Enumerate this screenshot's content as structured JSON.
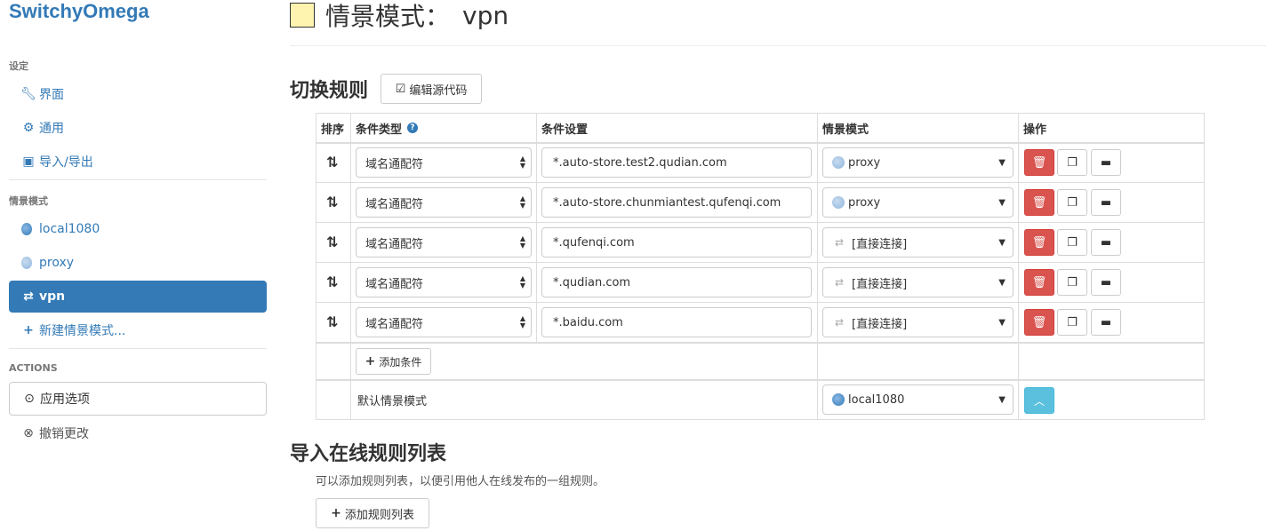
{
  "app": {
    "title": "SwitchyOmega"
  },
  "sidebar": {
    "settings_header": "设定",
    "settings_items": [
      {
        "label": "界面",
        "icon": "wrench-icon"
      },
      {
        "label": "通用",
        "icon": "gear-icon"
      },
      {
        "label": "导入/导出",
        "icon": "floppy-icon"
      }
    ],
    "profiles_header": "情景模式",
    "profile_items": [
      {
        "label": "local1080",
        "icon": "globe-icon"
      },
      {
        "label": "proxy",
        "icon": "globe-icon"
      },
      {
        "label": "vpn",
        "icon": "switch-icon",
        "active": true
      }
    ],
    "new_profile": "新建情景模式...",
    "actions_header": "ACTIONS",
    "apply": "应用选项",
    "discard": "撤销更改"
  },
  "page": {
    "title_prefix": "情景模式：",
    "profile_name": "vpn",
    "swatch_color": "#fff3b0"
  },
  "rules_section": {
    "title": "切换规则",
    "edit_source": "编辑源代码",
    "columns": {
      "sort": "排序",
      "condition_type": "条件类型",
      "condition": "条件设置",
      "profile": "情景模式",
      "actions": "操作"
    },
    "rows": [
      {
        "type": "域名通配符",
        "pattern": "*.auto-store.test2.qudian.com",
        "profile": "proxy",
        "profile_icon": "globe-icon"
      },
      {
        "type": "域名通配符",
        "pattern": "*.auto-store.chunmiantest.qufenqi.com",
        "profile": "proxy",
        "profile_icon": "globe-icon"
      },
      {
        "type": "域名通配符",
        "pattern": "*.qufenqi.com",
        "profile": "[直接连接]",
        "profile_icon": "direct-icon"
      },
      {
        "type": "域名通配符",
        "pattern": "*.qudian.com",
        "profile": "[直接连接]",
        "profile_icon": "direct-icon"
      },
      {
        "type": "域名通配符",
        "pattern": "*.baidu.com",
        "profile": "[直接连接]",
        "profile_icon": "direct-icon"
      }
    ],
    "add_condition": "添加条件",
    "default_label": "默认情景模式",
    "default_profile": "local1080"
  },
  "rule_lists": {
    "title": "导入在线规则列表",
    "description": "可以添加规则列表，以便引用他人在线发布的一组规则。",
    "add_button": "添加规则列表"
  },
  "colors": {
    "accent": "#337ab7",
    "danger": "#d9534f",
    "info": "#5bc0de"
  }
}
